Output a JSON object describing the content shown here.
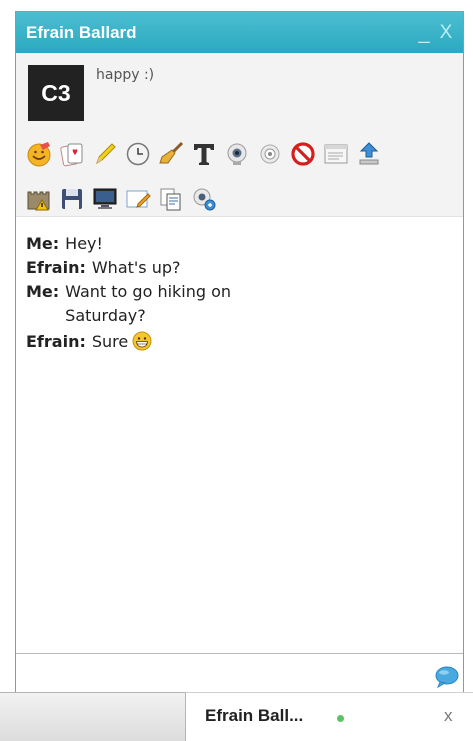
{
  "window": {
    "title": "Efrain Ballard",
    "minimize_label": "_",
    "close_label": "X"
  },
  "profile": {
    "avatar_text": "C3",
    "status_message": "happy :)"
  },
  "toolbar": {
    "row1": [
      "emoticon-icon",
      "games-icon",
      "pencil-icon",
      "clock-icon",
      "broom-icon",
      "font-icon",
      "webcam-icon",
      "audio-icon",
      "block-icon",
      "window-icon",
      "upload-icon"
    ],
    "row2": [
      "castle-warning-icon",
      "save-icon",
      "screen-share-icon",
      "whiteboard-icon",
      "copy-icon",
      "search-webcam-icon"
    ]
  },
  "messages": [
    {
      "sender": "Me:",
      "text": "Hey!"
    },
    {
      "sender": "Efrain:",
      "text": "What's up?"
    },
    {
      "sender": "Me:",
      "text": "Want to go hiking on Saturday?"
    },
    {
      "sender": "Efrain:",
      "text": "Sure",
      "emoji": "grin-emoji"
    }
  ],
  "input": {
    "value": "",
    "send_icon": "speech-bubble-icon"
  },
  "dock": {
    "tab_label": "Efrain Ball...",
    "close_label": "x",
    "presence_color": "#5cc266"
  },
  "colors": {
    "titlebar": "#3bb4c9",
    "border": "#6ea3ba"
  }
}
